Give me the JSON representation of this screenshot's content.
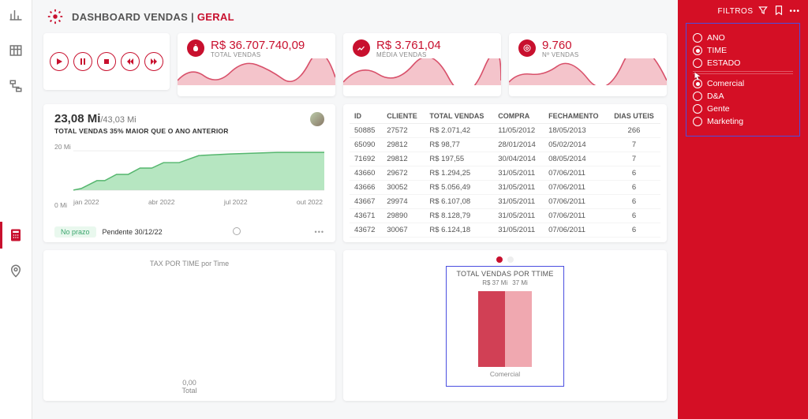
{
  "header": {
    "title_left": "DASHBOARD VENDAS | ",
    "title_accent": "GERAL"
  },
  "kpi": {
    "total": {
      "value": "R$ 36.707.740,09",
      "label": "TOTAL VENDAS"
    },
    "avg": {
      "value": "R$ 3.761,04",
      "label": "MÉDIA VENDAS"
    },
    "count": {
      "value": "9.760",
      "label": "Nº VENDAS"
    }
  },
  "area": {
    "value": "23,08 Mi",
    "value_sub": "/43,03 Mi",
    "subtitle": "TOTAL VENDAS 35% MAIOR QUE O ANO ANTERIOR",
    "y_ticks": [
      "20 Mi",
      "0 Mi"
    ],
    "x_ticks": [
      "jan 2022",
      "abr 2022",
      "jul 2022",
      "out 2022"
    ],
    "status_pill": "No prazo",
    "status_text": "Pendente 30/12/22"
  },
  "table": {
    "cols": [
      "ID",
      "CLIENTE",
      "TOTAL VENDAS",
      "COMPRA",
      "FECHAMENTO",
      "DIAS UTEIS"
    ],
    "rows": [
      [
        "50885",
        "27572",
        "R$ 2.071,42",
        "11/05/2012",
        "18/05/2013",
        "266"
      ],
      [
        "65090",
        "29812",
        "R$ 98,77",
        "28/01/2014",
        "05/02/2014",
        "7"
      ],
      [
        "71692",
        "29812",
        "R$ 197,55",
        "30/04/2014",
        "08/05/2014",
        "7"
      ],
      [
        "43660",
        "29672",
        "R$ 1.294,25",
        "31/05/2011",
        "07/06/2011",
        "6"
      ],
      [
        "43666",
        "30052",
        "R$ 5.056,49",
        "31/05/2011",
        "07/06/2011",
        "6"
      ],
      [
        "43667",
        "29974",
        "R$ 6.107,08",
        "31/05/2011",
        "07/06/2011",
        "6"
      ],
      [
        "43671",
        "29890",
        "R$ 8.128,79",
        "31/05/2011",
        "07/06/2011",
        "6"
      ],
      [
        "43672",
        "30067",
        "R$ 6.124,18",
        "31/05/2011",
        "07/06/2011",
        "6"
      ]
    ]
  },
  "tax_card": {
    "title": "TAX POR TIME por Time",
    "value": "0,00",
    "label": "Total"
  },
  "barcard": {
    "title": "TOTAL VENDAS POR TTIME",
    "labels": [
      "R$ 37 Mi",
      "37 Mi"
    ],
    "category": "Comercial"
  },
  "filters": {
    "header": "FILTROS",
    "group1": [
      {
        "label": "ANO",
        "selected": false
      },
      {
        "label": "TIME",
        "selected": true
      },
      {
        "label": "ESTADO",
        "selected": false
      }
    ],
    "group2": [
      {
        "label": "Comercial",
        "selected": true
      },
      {
        "label": "D&A",
        "selected": false
      },
      {
        "label": "Gente",
        "selected": false
      },
      {
        "label": "Marketing",
        "selected": false
      }
    ]
  },
  "chart_data": [
    {
      "type": "area",
      "title": "TOTAL VENDAS 35% MAIOR QUE O ANO ANTERIOR",
      "x": [
        "jan 2022",
        "fev 2022",
        "mar 2022",
        "abr 2022",
        "mai 2022",
        "jun 2022",
        "jul 2022",
        "ago 2022",
        "set 2022",
        "out 2022",
        "nov 2022",
        "dez 2022"
      ],
      "values": [
        0,
        3,
        7,
        12,
        15,
        18,
        20,
        22,
        22,
        22,
        23,
        23.08
      ],
      "ylabel": "Mi",
      "ylim": [
        0,
        25
      ]
    },
    {
      "type": "bar",
      "title": "TOTAL VENDAS POR TTIME",
      "categories": [
        "Comercial"
      ],
      "series": [
        {
          "name": "R$ 37 Mi",
          "values": [
            37
          ]
        },
        {
          "name": "37 Mi",
          "values": [
            37
          ]
        }
      ],
      "ylim": [
        0,
        40
      ]
    }
  ]
}
